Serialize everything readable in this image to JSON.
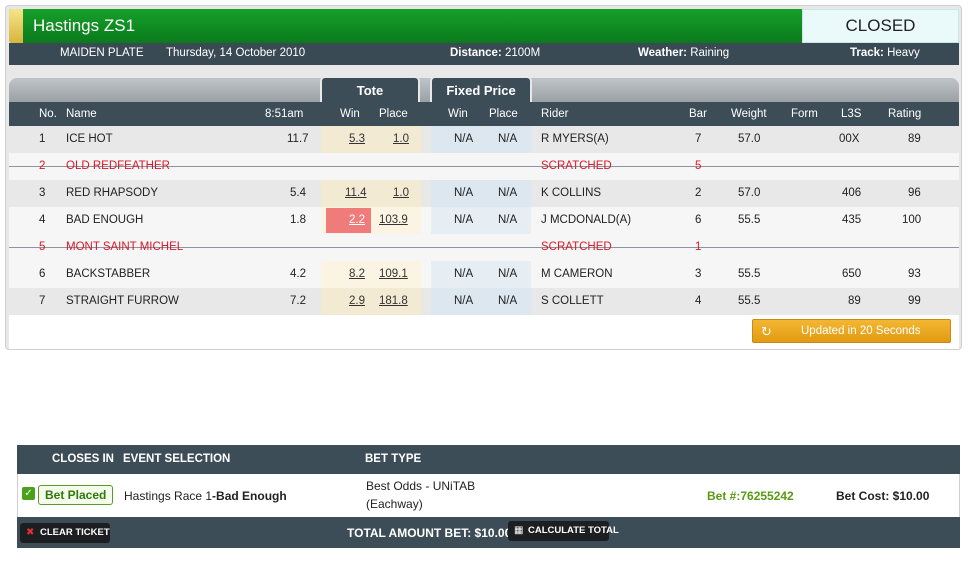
{
  "race": {
    "title": "Hastings ZS1",
    "status": "CLOSED",
    "race_name": "MAIDEN PLATE",
    "date": "Thursday, 14 October 2010",
    "distance_label": "Distance:",
    "distance": "2100M",
    "weather_label": "Weather:",
    "weather": "Raining",
    "track_label": "Track:",
    "track": "Heavy"
  },
  "tabs": {
    "tote": "Tote",
    "fixed_price": "Fixed Price"
  },
  "columns": {
    "no": "No.",
    "name": "Name",
    "time": "8:51am",
    "tote_win": "Win",
    "tote_place": "Place",
    "fp_win": "Win",
    "fp_place": "Place",
    "rider": "Rider",
    "bar": "Bar",
    "weight": "Weight",
    "form": "Form",
    "l3s": "L3S",
    "rating": "Rating"
  },
  "runners": [
    {
      "no": "1",
      "name": "ICE HOT",
      "odds": "11.7",
      "tote_win": "5.3",
      "tote_place": "1.0",
      "fp_win": "N/A",
      "fp_place": "N/A",
      "rider": "R MYERS(A)",
      "bar": "7",
      "weight": "57.0",
      "form": "",
      "l3s": "00X",
      "rating": "89"
    },
    {
      "no": "2",
      "name": "OLD REDFEATHER",
      "scratched_label": "SCRATCHED",
      "bar": "5"
    },
    {
      "no": "3",
      "name": "RED RHAPSODY",
      "odds": "5.4",
      "tote_win": "11.4",
      "tote_place": "1.0",
      "fp_win": "N/A",
      "fp_place": "N/A",
      "rider": "K COLLINS",
      "bar": "2",
      "weight": "57.0",
      "form": "",
      "l3s": "406",
      "rating": "96"
    },
    {
      "no": "4",
      "name": "BAD ENOUGH",
      "odds": "1.8",
      "tote_win": "2.2",
      "tote_place": "103.9",
      "fp_win": "N/A",
      "fp_place": "N/A",
      "rider": "J MCDONALD(A)",
      "bar": "6",
      "weight": "55.5",
      "form": "",
      "l3s": "435",
      "rating": "100"
    },
    {
      "no": "5",
      "name": "MONT SAINT MICHEL",
      "scratched_label": "SCRATCHED",
      "bar": "1"
    },
    {
      "no": "6",
      "name": "BACKSTABBER",
      "odds": "4.2",
      "tote_win": "8.2",
      "tote_place": "109.1",
      "fp_win": "N/A",
      "fp_place": "N/A",
      "rider": "M CAMERON",
      "bar": "3",
      "weight": "55.5",
      "form": "",
      "l3s": "650",
      "rating": "93"
    },
    {
      "no": "7",
      "name": "STRAIGHT FURROW",
      "odds": "7.2",
      "tote_win": "2.9",
      "tote_place": "181.8",
      "fp_win": "N/A",
      "fp_place": "N/A",
      "rider": "S COLLETT",
      "bar": "4",
      "weight": "55.5",
      "form": "",
      "l3s": "89",
      "rating": "99"
    }
  ],
  "update_button": {
    "icon": "refresh-icon",
    "label": "Updated in 20 Seconds"
  },
  "betslip": {
    "headers": {
      "closes_in": "CLOSES IN",
      "event_selection": "EVENT SELECTION",
      "bet_type": "BET TYPE"
    },
    "bet": {
      "status": "Bet Placed",
      "event": "Hastings Race 1",
      "selection": "-Bad Enough",
      "bet_type_line1": "Best Odds - UNiTAB",
      "bet_type_line2": "(Eachway)",
      "bet_number": "Bet #:76255242",
      "bet_cost": "Bet Cost: $10.00"
    },
    "clear_ticket": "CLEAR TICKET",
    "total_amount": "TOTAL AMOUNT BET: $10.00",
    "calculate_total": "CALCULATE TOTAL"
  },
  "colors": {
    "title_green": "#0e8a22",
    "dark_header": "#3d4d57",
    "scratched_red": "#d8192a",
    "update_orange": "#eaa520",
    "highlight_red": "#f07b7b"
  }
}
